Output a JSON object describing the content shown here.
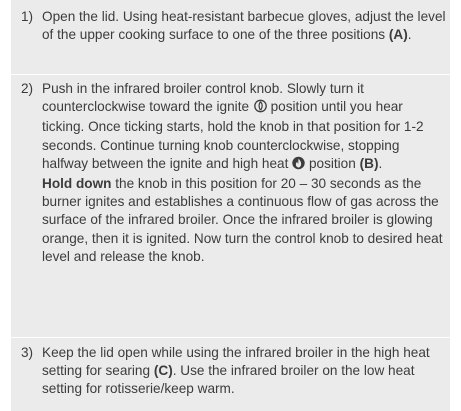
{
  "steps": [
    {
      "number": "1)",
      "text_a": "Open the lid. Using heat-resistant barbecue gloves, adjust the level of the upper cooking surface to one of the three positions ",
      "ref": "(A)",
      "text_b": "."
    },
    {
      "number": "2)",
      "text_a": "Push in the infrared broiler control knob. Slowly turn it counterclockwise toward the ignite ",
      "text_b": " position until you hear ticking. Once ticking starts, hold the knob in that position for 1-2 seconds. Continue turning knob counterclockwise, stopping halfway between the ignite and high heat ",
      "text_c": " position ",
      "ref": "(B)",
      "text_d": ".",
      "emphasis": "Hold down",
      "text_e": " the knob in this position for 20 – 30 seconds as the burner ignites and establishes a continuous flow of gas across the surface of the infrared broiler. Once the infrared broiler is glowing orange, then it is ignited. Now turn the control knob to desired heat level and release the knob.",
      "ignite_icon": "ignite-symbol-icon",
      "high_heat_icon": "high-heat-flame-icon"
    },
    {
      "number": "3)",
      "text_a": "Keep the lid open while using the infrared broiler in the high heat setting for searing ",
      "ref": "(C)",
      "text_b": ". Use the infrared broiler on the low heat setting for rotisserie/keep warm."
    }
  ],
  "colors": {
    "panel_background": "#ebebeb",
    "text": "#3c3c3c",
    "divider": "#ffffff"
  }
}
